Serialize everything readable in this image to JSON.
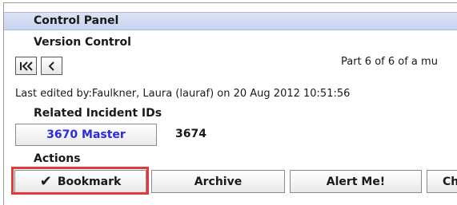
{
  "panel": {
    "title": "Control Panel"
  },
  "version_control": {
    "title": "Version Control",
    "first_icon": "first-page-icon",
    "prev_icon": "previous-page-icon",
    "page_info": "Part 6 of 6 of a mu",
    "last_edited": "Last edited by:Faulkner, Laura (lauraf) on 20 Aug 2012 10:51:56"
  },
  "related": {
    "title": "Related Incident IDs",
    "ids": [
      "3670 Master",
      "3674"
    ]
  },
  "actions": {
    "title": "Actions",
    "check_glyph": "✔",
    "check_icon": "checkmark-icon",
    "buttons": [
      "Bookmark",
      "Archive",
      "Alert Me!",
      "Ch"
    ],
    "highlight_color": "#e23a3a"
  },
  "colors": {
    "header_bg": "#c7d4ee",
    "link_blue": "#2a2adf"
  }
}
